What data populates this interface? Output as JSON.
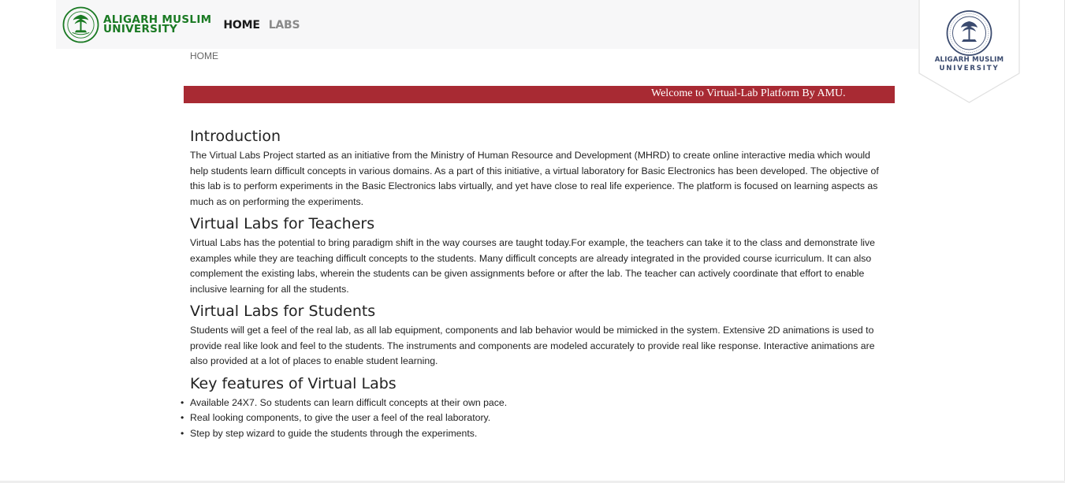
{
  "navbar": {
    "brand_line1": "ALIGARH MUSLIM",
    "brand_line2": "UNIVERSITY",
    "links": [
      {
        "label": "HOME",
        "active": true
      },
      {
        "label": "LABS",
        "active": false
      }
    ],
    "brand_color": "#1a7a23"
  },
  "shield_logo": {
    "line1": "ALIGARH MUSLIM",
    "line2": "UNIVERSITY",
    "color": "#3a4a6e"
  },
  "breadcrumb": "HOME",
  "welcome": {
    "text": "Welcome to Virtual-Lab Platform By AMU.",
    "background": "#a82a33"
  },
  "sections": [
    {
      "title": "Introduction",
      "body": "The Virtual Labs Project started as an initiative from the Ministry of Human Resource and Development (MHRD) to create online interactive media which would help students learn difficult concepts in various domains. As a part of this initiative, a virtual laboratory for Basic Electronics has been developed. The objective of this lab is to perform experiments in the Basic Electronics labs virtually, and yet have close to real life experience. The platform is focused on learning aspects as much as on performing the experiments."
    },
    {
      "title": "Virtual Labs for Teachers",
      "body": "Virtual Labs has the potential to bring paradigm shift in the way courses are taught today.For example, the teachers can take it to the class and demonstrate live examples while they are teaching difficult concepts to the students. Many difficult concepts are already integrated in the provided course icurriculum. It can also complement the existing labs, wherein the students can be given assignments before or after the lab. The teacher can actively coordinate that effort to enable inclusive learning for all the students."
    },
    {
      "title": "Virtual Labs for Students",
      "body": "Students will get a feel of the real lab, as all lab equipment, components and lab behavior would be mimicked in the system. Extensive 2D animations is used to provide real like look and feel to the students. The instruments and components are modeled accurately to provide real like response. Interactive animations are also provided at a lot of places to enable student learning."
    }
  ],
  "features": {
    "title": "Key features of Virtual Labs",
    "items": [
      "Available 24X7. So students can learn difficult concepts at their own pace.",
      "Real looking components, to give the user a feel of the real laboratory.",
      "Step by step wizard to guide the students through the experiments."
    ]
  }
}
